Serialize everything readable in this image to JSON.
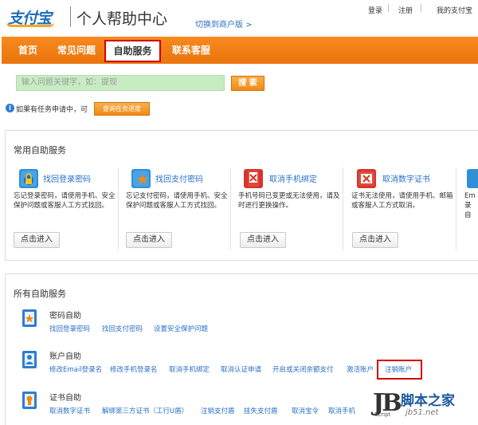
{
  "header": {
    "logo_text": "支付宝",
    "title": "个人帮助中心",
    "switch_link": "切换到商户版 >",
    "login": "登录",
    "register": "注册",
    "my_alipay": "我的支付宝"
  },
  "nav": {
    "items": [
      "首页",
      "常见问题",
      "自助服务",
      "联系客服"
    ],
    "active": "自助服务"
  },
  "search": {
    "placeholder": "输入问题关键字，如：提现",
    "button": "搜 索"
  },
  "task": {
    "text": "如果有任务申请中，可",
    "button": "查询任务进度"
  },
  "common_services": {
    "title": "常用自助服务",
    "items": [
      {
        "title": "找回登录密码",
        "desc": "忘记登录密码，请使用手机、安全保护问题或客服人工方式找回。",
        "button": "点击进入",
        "icon": "lock-recovery-icon",
        "color": "#2f8fd8"
      },
      {
        "title": "找回支付密码",
        "desc": "忘记支付密码，请使用手机、安全保护问题或客服人工方式找回。",
        "button": "点击进入",
        "icon": "star-recovery-icon",
        "color": "#2f8fd8"
      },
      {
        "title": "取消手机绑定",
        "desc": "手机号码已变更或无法使用，请及时进行更换操作。",
        "button": "点击进入",
        "icon": "phone-cancel-icon",
        "color": "#d9342b"
      },
      {
        "title": "取消数字证书",
        "desc": "证书无法使用，请使用手机、邮箱或客服人工方式取消。",
        "button": "点击进入",
        "icon": "cert-cancel-icon",
        "color": "#d9342b"
      },
      {
        "title": "",
        "desc": "Em录自",
        "button": "",
        "icon": "partial-icon",
        "color": "#2f8fd8"
      }
    ]
  },
  "all_services": {
    "title": "所有自助服务",
    "categories": [
      {
        "title": "密码自助",
        "icon": "password-self-service-icon",
        "links": [
          "找回登录密码",
          "找回支付密码",
          "设置安全保护问题"
        ]
      },
      {
        "title": "账户自助",
        "icon": "account-self-service-icon",
        "links": [
          "修改Email登录名",
          "修改手机登录名",
          "取消手机绑定",
          "取消认证申请",
          "开启或关闭余额支付",
          "激活账户",
          "注销账户"
        ]
      },
      {
        "title": "证书自助",
        "icon": "cert-self-service-icon",
        "links": [
          "取消数字证书",
          "解绑第三方证书（工行U盾）",
          "注销支付盾",
          "挂失支付盾",
          "取消宝令",
          "取消手机"
        ]
      }
    ],
    "highlighted": "注销账户"
  },
  "watermark": {
    "jb": "JB",
    "script": "Script",
    "site_name": "脚本之家",
    "url": "jb51.net"
  }
}
